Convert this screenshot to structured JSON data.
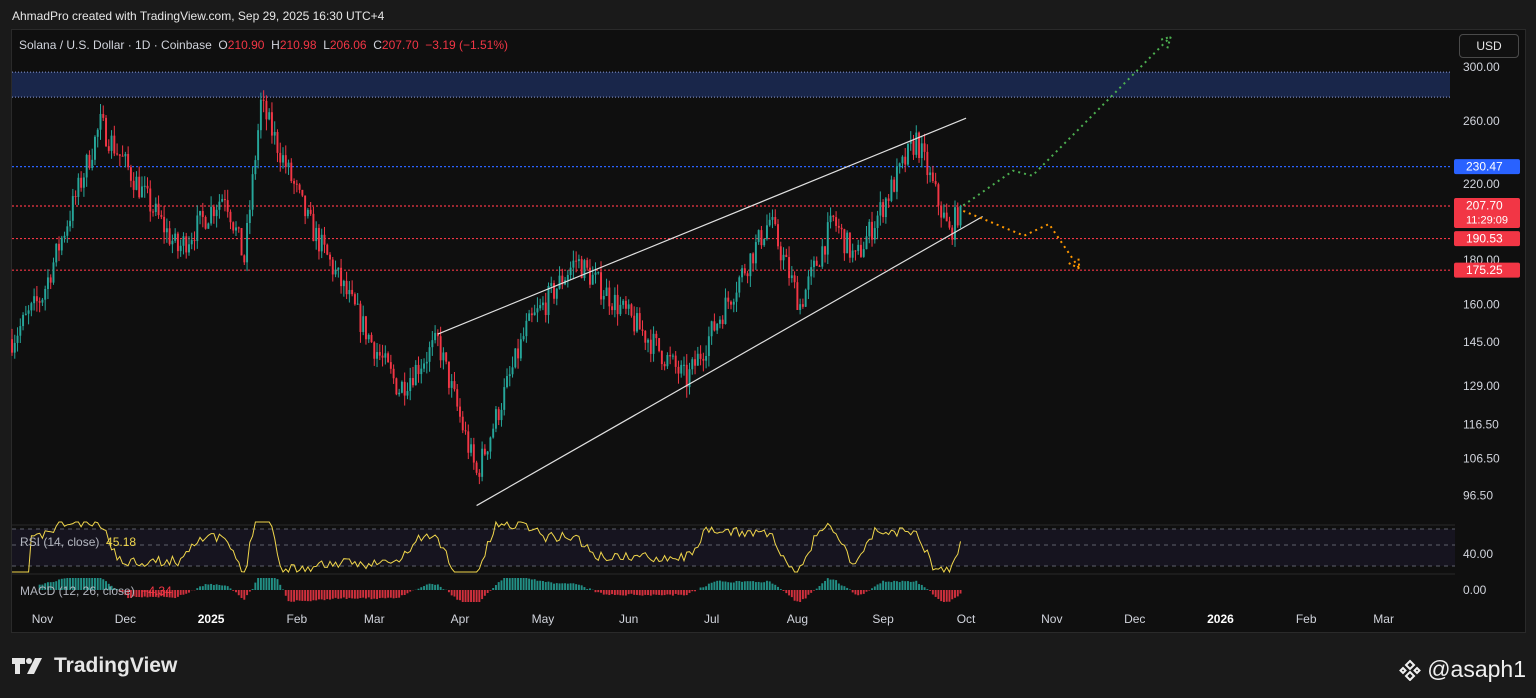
{
  "header": {
    "credit": "AhmadPro created with TradingView.com, Sep 29, 2025 16:30 UTC+4"
  },
  "legend": {
    "symbol": "Solana / U.S. Dollar · 1D · Coinbase",
    "o_label": "O",
    "o": "210.90",
    "h_label": "H",
    "h": "210.98",
    "l_label": "L",
    "l": "206.06",
    "c_label": "C",
    "c": "207.70",
    "change": "−3.19 (−1.51%)"
  },
  "currency_button": "USD",
  "price_axis": [
    "300.00",
    "260.00",
    "220.00",
    "180.00",
    "160.00",
    "145.00",
    "129.00",
    "116.50",
    "106.50",
    "96.50"
  ],
  "price_badges": [
    {
      "value": "230.47",
      "color": "#2962ff"
    },
    {
      "value": "207.70",
      "sub": "11:29:09",
      "color": "#f23645"
    },
    {
      "value": "190.53",
      "color": "#f23645"
    },
    {
      "value": "175.25",
      "color": "#f23645"
    }
  ],
  "time_axis": [
    "Nov",
    "Dec",
    "2025",
    "Feb",
    "Mar",
    "Apr",
    "May",
    "Jun",
    "Jul",
    "Aug",
    "Sep",
    "Oct",
    "Nov",
    "Dec",
    "2026",
    "Feb",
    "Mar"
  ],
  "rsi": {
    "label": "RSI (14, close)",
    "value": "45.18",
    "axis": "40.00",
    "color": "#f0d64b"
  },
  "macd": {
    "label": "MACD (12, 26, close)",
    "value": "−4.34",
    "axis": "0.00"
  },
  "footer": {
    "brand": "TradingView",
    "watermark": "@asaph1"
  },
  "colors": {
    "up": "#26a69a",
    "down": "#f23645",
    "zone": "#1b2a55",
    "blue_line": "#2962ff",
    "bull_path": "#4caf50",
    "bear_path": "#ff9800",
    "channel": "#e0e0e0"
  },
  "chart_data": {
    "type": "candlestick",
    "title": "Solana / U.S. Dollar · 1D · Coinbase",
    "ylim": [
      90,
      330
    ],
    "y_scale": "log",
    "x_range": [
      "2024-10-21",
      "2026-03-25"
    ],
    "resistance_zone": [
      277,
      296
    ],
    "levels": [
      230.47,
      207.7,
      190.53,
      175.25
    ],
    "key_points": [
      {
        "date": "2024-10-21",
        "price": 146
      },
      {
        "date": "2024-11-01",
        "price": 164
      },
      {
        "date": "2024-11-22",
        "price": 258
      },
      {
        "date": "2024-12-20",
        "price": 185
      },
      {
        "date": "2025-01-06",
        "price": 215
      },
      {
        "date": "2025-01-13",
        "price": 180
      },
      {
        "date": "2025-01-19",
        "price": 272
      },
      {
        "date": "2025-02-05",
        "price": 200
      },
      {
        "date": "2025-02-28",
        "price": 145
      },
      {
        "date": "2025-03-10",
        "price": 128
      },
      {
        "date": "2025-03-24",
        "price": 145
      },
      {
        "date": "2025-04-07",
        "price": 102
      },
      {
        "date": "2025-04-25",
        "price": 150
      },
      {
        "date": "2025-05-13",
        "price": 180
      },
      {
        "date": "2025-06-05",
        "price": 150
      },
      {
        "date": "2025-06-22",
        "price": 131
      },
      {
        "date": "2025-07-22",
        "price": 200
      },
      {
        "date": "2025-08-02",
        "price": 160
      },
      {
        "date": "2025-08-14",
        "price": 200
      },
      {
        "date": "2025-08-22",
        "price": 180
      },
      {
        "date": "2025-09-13",
        "price": 248
      },
      {
        "date": "2025-09-25",
        "price": 193
      },
      {
        "date": "2025-09-29",
        "price": 207.7
      }
    ],
    "channel": {
      "upper": [
        [
          "2025-03-24",
          148
        ],
        [
          "2025-10-01",
          262
        ]
      ],
      "lower": [
        [
          "2025-04-07",
          94
        ],
        [
          "2025-10-07",
          202
        ]
      ]
    },
    "projections": {
      "bullish": [
        [
          "2025-09-30",
          208
        ],
        [
          "2025-10-18",
          228
        ],
        [
          "2025-10-25",
          225
        ],
        [
          "2025-12-14",
          325
        ]
      ],
      "bearish": [
        [
          "2025-09-30",
          205
        ],
        [
          "2025-10-22",
          192
        ],
        [
          "2025-10-31",
          198
        ],
        [
          "2025-11-11",
          176
        ]
      ]
    }
  }
}
